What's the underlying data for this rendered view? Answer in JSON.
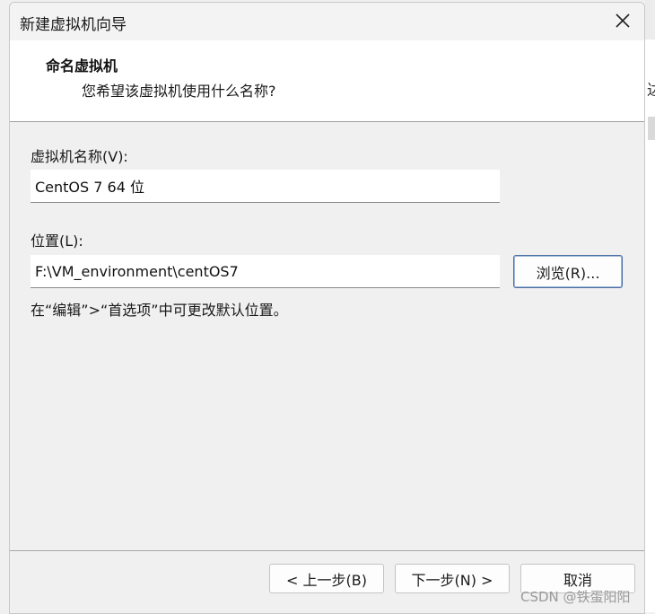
{
  "window": {
    "title": "新建虚拟机向导"
  },
  "header": {
    "title": "命名虚拟机",
    "subtitle": "您希望该虚拟机使用什么名称?"
  },
  "form": {
    "name_label": "虚拟机名称(V):",
    "name_value": "CentOS 7 64 位",
    "location_label": "位置(L):",
    "location_value": "F:\\VM_environment\\centOS7",
    "browse_label": "浏览(R)...",
    "hint": "在“编辑”>“首选项”中可更改默认位置。"
  },
  "footer": {
    "back_label": "< 上一步(B)",
    "next_label": "下一步(N) >",
    "cancel_label": "取消"
  },
  "background": {
    "partial_char": "达"
  },
  "watermark": "CSDN @铁蛋阳阳",
  "colors": {
    "header_bg": "#ffffff",
    "dialog_bg": "#f0f0f0",
    "focus_border": "#4a6fa5"
  },
  "icons": {
    "close": "close-icon"
  }
}
